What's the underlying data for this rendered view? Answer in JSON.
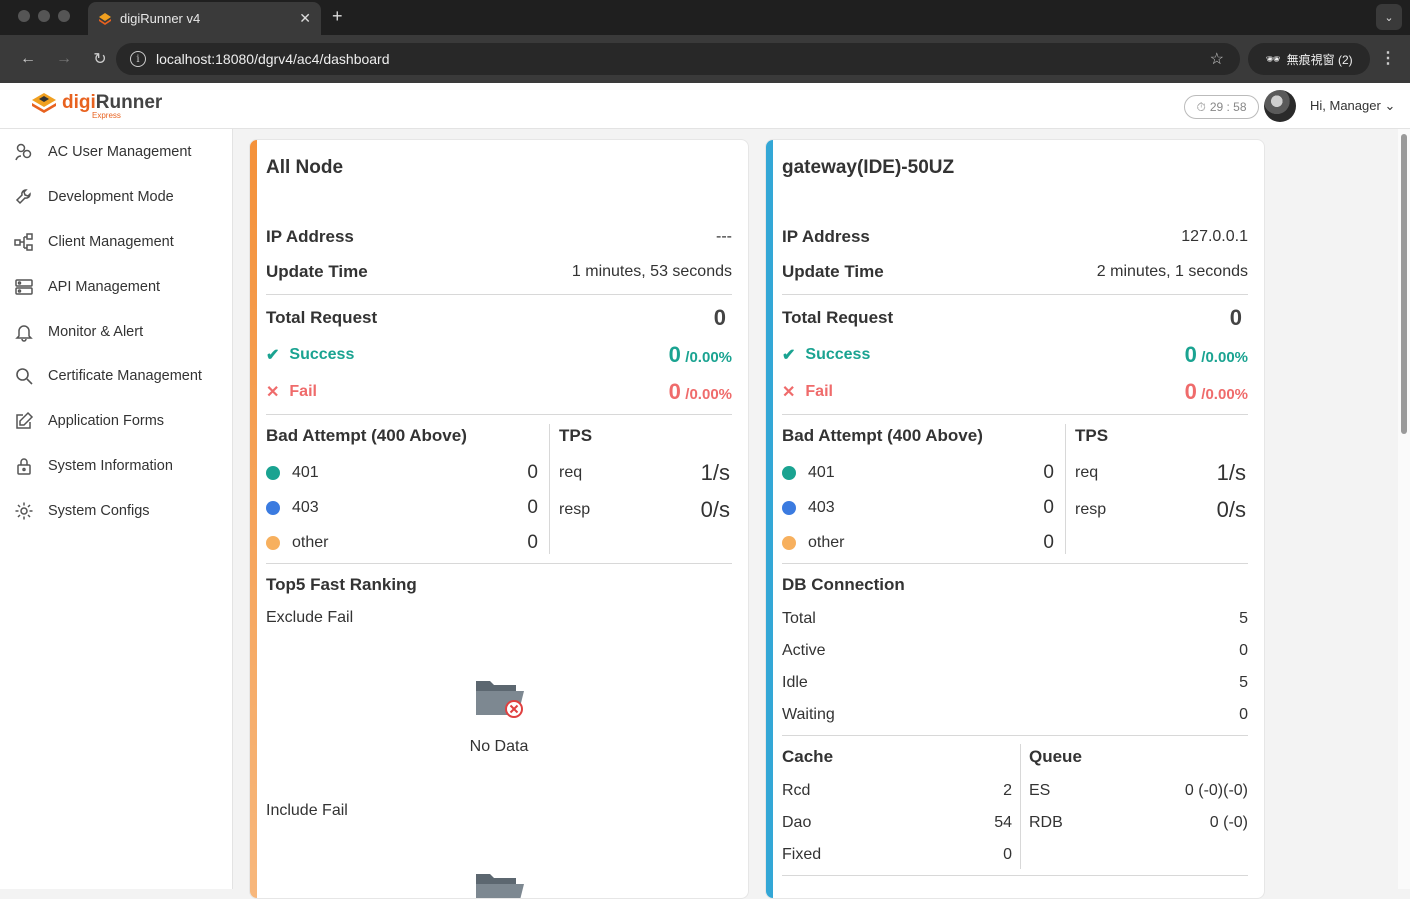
{
  "browser": {
    "tab_title": "digiRunner v4",
    "url": "localhost:18080/dgrv4/ac4/dashboard",
    "incognito_label": "無痕視窗 (2)"
  },
  "header": {
    "logo_brand_a": "digi",
    "logo_brand_b": "Runner",
    "logo_sub": "Express",
    "timer": "29 : 58",
    "greeting": "Hi, Manager"
  },
  "sidebar": {
    "items": [
      {
        "label": "AC User Management",
        "icon": "users-icon"
      },
      {
        "label": "Development Mode",
        "icon": "wrench-icon"
      },
      {
        "label": "Client Management",
        "icon": "network-icon"
      },
      {
        "label": "API Management",
        "icon": "server-icon"
      },
      {
        "label": "Monitor & Alert",
        "icon": "bell-icon"
      },
      {
        "label": "Certificate Management",
        "icon": "search-icon"
      },
      {
        "label": "Application Forms",
        "icon": "edit-icon"
      },
      {
        "label": "System Information",
        "icon": "lock-icon"
      },
      {
        "label": "System Configs",
        "icon": "gear-icon"
      }
    ]
  },
  "colors": {
    "allnode_bar": "#f4913a",
    "gateway_bar": "#33a7d6",
    "success": "#1aa391",
    "fail": "#ef6b6b",
    "c401": "#1aa391",
    "c403": "#3b7be0",
    "other": "#f7b05e"
  },
  "all_node": {
    "title": "All Node",
    "ip_label": "IP Address",
    "ip_value": "---",
    "update_label": "Update Time",
    "update_value": "1 minutes, 53 seconds",
    "total_label": "Total Request",
    "total_value": "0",
    "success_label": "Success",
    "success_value": "0",
    "success_pct": "/0.00%",
    "fail_label": "Fail",
    "fail_value": "0",
    "fail_pct": "/0.00%",
    "bad_title": "Bad Attempt (400 Above)",
    "bad": [
      {
        "label": "401",
        "value": "0"
      },
      {
        "label": "403",
        "value": "0"
      },
      {
        "label": "other",
        "value": "0"
      }
    ],
    "tps_title": "TPS",
    "tps_req_label": "req",
    "tps_req_value": "1/s",
    "tps_resp_label": "resp",
    "tps_resp_value": "0/s",
    "top5_title": "Top5 Fast Ranking",
    "exclude_label": "Exclude Fail",
    "no_data": "No Data",
    "include_label": "Include Fail"
  },
  "gateway": {
    "title": "gateway(IDE)-50UZ",
    "ip_label": "IP Address",
    "ip_value": "127.0.0.1",
    "update_label": "Update Time",
    "update_value": "2 minutes, 1 seconds",
    "total_label": "Total Request",
    "total_value": "0",
    "success_label": "Success",
    "success_value": "0",
    "success_pct": "/0.00%",
    "fail_label": "Fail",
    "fail_value": "0",
    "fail_pct": "/0.00%",
    "bad_title": "Bad Attempt (400 Above)",
    "bad": [
      {
        "label": "401",
        "value": "0"
      },
      {
        "label": "403",
        "value": "0"
      },
      {
        "label": "other",
        "value": "0"
      }
    ],
    "tps_title": "TPS",
    "tps_req_label": "req",
    "tps_req_value": "1/s",
    "tps_resp_label": "resp",
    "tps_resp_value": "0/s",
    "db_title": "DB Connection",
    "db": [
      {
        "label": "Total",
        "value": "5"
      },
      {
        "label": "Active",
        "value": "0"
      },
      {
        "label": "Idle",
        "value": "5"
      },
      {
        "label": "Waiting",
        "value": "0"
      }
    ],
    "cache_title": "Cache",
    "cache": [
      {
        "label": "Rcd",
        "value": "2"
      },
      {
        "label": "Dao",
        "value": "54"
      },
      {
        "label": "Fixed",
        "value": "0"
      }
    ],
    "queue_title": "Queue",
    "queue": [
      {
        "label": "ES",
        "value": "0 (-0)(-0)"
      },
      {
        "label": "RDB",
        "value": "0 (-0)"
      }
    ]
  }
}
